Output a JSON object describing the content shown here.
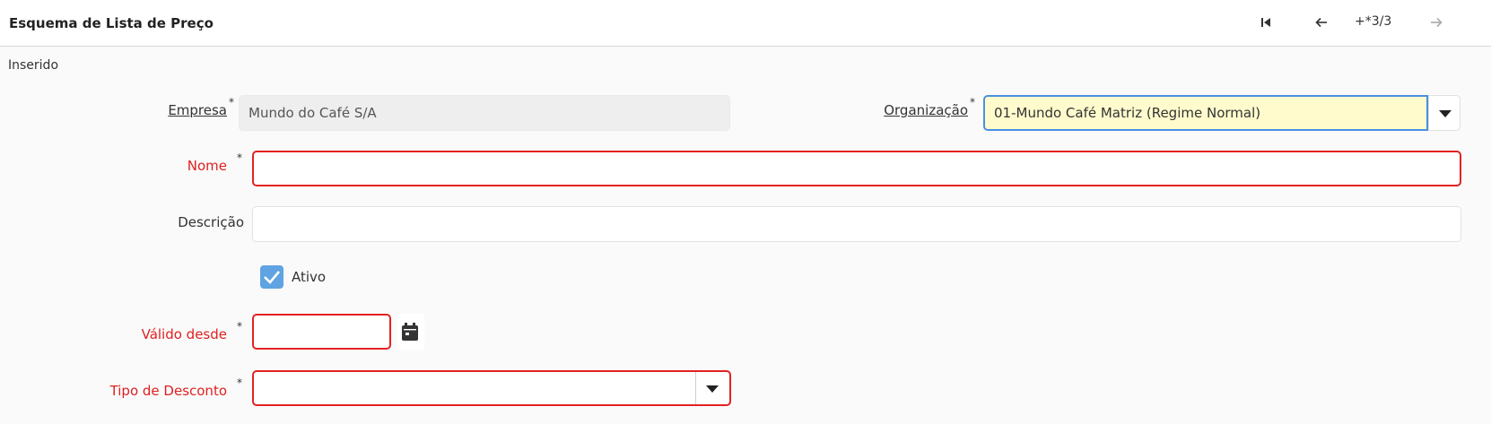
{
  "window": {
    "title": "Esquema de Lista de Preço",
    "nav_first_icon": "first-record-icon",
    "nav_prev_icon": "arrow-left-icon",
    "nav_next_icon": "arrow-right-icon",
    "record_status": "+*3/3"
  },
  "status": "Inserido",
  "form": {
    "empresa": {
      "label": "Empresa",
      "required": "*",
      "value": "Mundo do Café S/A"
    },
    "organizacao": {
      "label": "Organização",
      "required": "*",
      "value": "01-Mundo Café Matriz (Regime Normal)"
    },
    "nome": {
      "label": "Nome",
      "required": "*",
      "value": ""
    },
    "descricao": {
      "label": "Descrição",
      "value": ""
    },
    "ativo": {
      "label": "Ativo",
      "checked": true
    },
    "valido_desde": {
      "label": "Válido desde",
      "required": "*",
      "value": ""
    },
    "tipo_desconto": {
      "label": "Tipo de Desconto",
      "required": "*",
      "value": ""
    }
  },
  "colors": {
    "required_label": "#e02020",
    "error_border": "#e32222",
    "focus_border": "#4a90e2",
    "focus_background": "#fffbcc",
    "checkbox": "#5fa3e3"
  }
}
